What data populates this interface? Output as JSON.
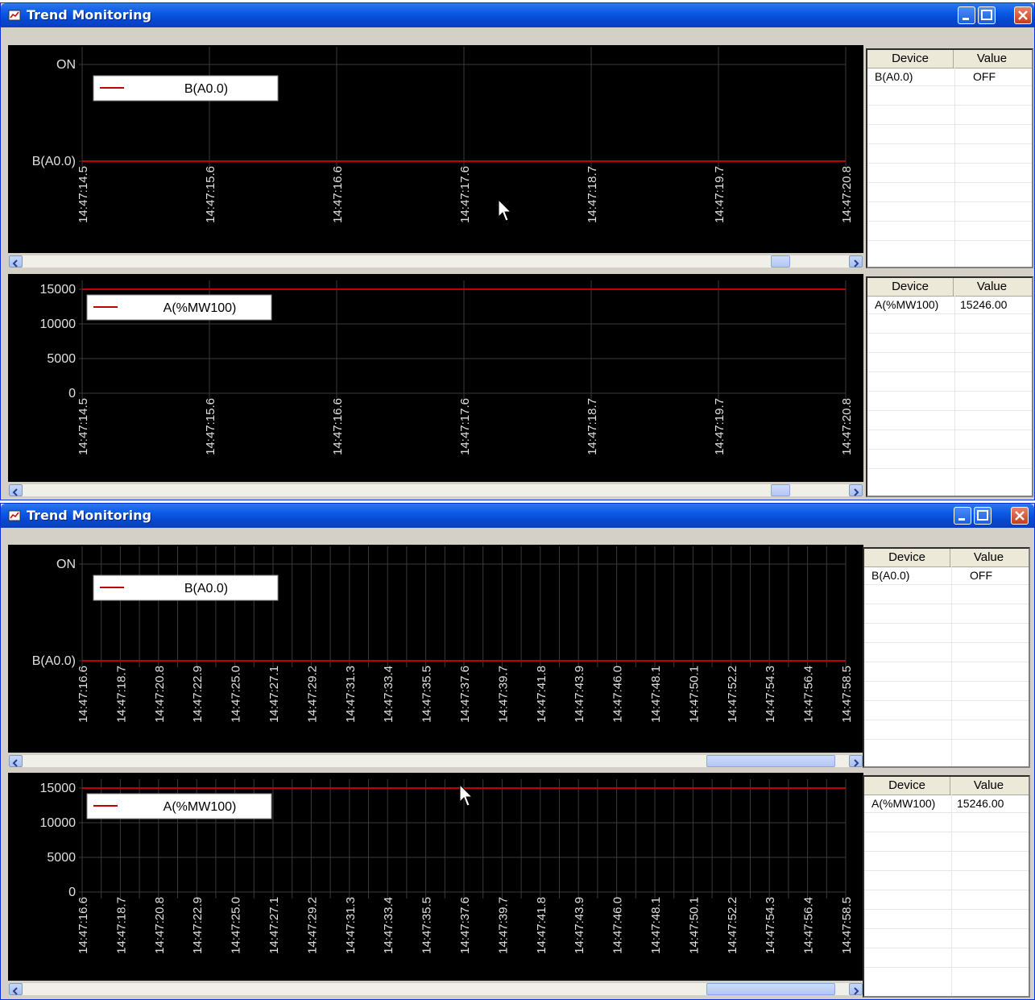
{
  "windows": [
    {
      "title": "Trend Monitoring",
      "charts": [
        {
          "legend": "B(A0.0)",
          "y_ticks": [
            "ON",
            "B(A0.0)"
          ],
          "x_ticks": [
            "14:47:14.5",
            "14:47:15.6",
            "14:47:16.6",
            "14:47:17.6",
            "14:47:18.7",
            "14:47:19.7",
            "14:47:20.8"
          ],
          "grid_count": 6,
          "line_level": 0,
          "table": {
            "headers": [
              "Device",
              "Value"
            ],
            "rows": [
              [
                "B(A0.0)",
                "OFF"
              ]
            ]
          }
        },
        {
          "legend": "A(%MW100)",
          "y_ticks": [
            "15000",
            "10000",
            "5000",
            "0"
          ],
          "x_ticks": [
            "14:47:14.5",
            "14:47:15.6",
            "14:47:16.6",
            "14:47:17.6",
            "14:47:18.7",
            "14:47:19.7",
            "14:47:20.8"
          ],
          "grid_count": 6,
          "line_level": 15000,
          "table": {
            "headers": [
              "Device",
              "Value"
            ],
            "rows": [
              [
                "A(%MW100)",
                "15246.00"
              ]
            ]
          }
        }
      ]
    },
    {
      "title": "Trend Monitoring",
      "charts": [
        {
          "legend": "B(A0.0)",
          "y_ticks": [
            "ON",
            "B(A0.0)"
          ],
          "x_ticks": [
            "14:47:16.6",
            "14:47:18.7",
            "14:47:20.8",
            "14:47:22.9",
            "14:47:25.0",
            "14:47:27.1",
            "14:47:29.2",
            "14:47:31.3",
            "14:47:33.4",
            "14:47:35.5",
            "14:47:37.6",
            "14:47:39.7",
            "14:47:41.8",
            "14:47:43.9",
            "14:47:46.0",
            "14:47:48.1",
            "14:47:50.1",
            "14:47:52.2",
            "14:47:54.3",
            "14:47:56.4",
            "14:47:58.5"
          ],
          "grid_count": 40,
          "line_level": 0,
          "table": {
            "headers": [
              "Device",
              "Value"
            ],
            "rows": [
              [
                "B(A0.0)",
                "OFF"
              ]
            ]
          }
        },
        {
          "legend": "A(%MW100)",
          "y_ticks": [
            "15000",
            "10000",
            "5000",
            "0"
          ],
          "x_ticks": [
            "14:47:16.6",
            "14:47:18.7",
            "14:47:20.8",
            "14:47:22.9",
            "14:47:25.0",
            "14:47:27.1",
            "14:47:29.2",
            "14:47:31.3",
            "14:47:33.4",
            "14:47:35.5",
            "14:47:37.6",
            "14:47:39.7",
            "14:47:41.8",
            "14:47:43.9",
            "14:47:46.0",
            "14:47:48.1",
            "14:47:50.1",
            "14:47:52.2",
            "14:47:54.3",
            "14:47:56.4",
            "14:47:58.5"
          ],
          "grid_count": 40,
          "line_level": 15000,
          "table": {
            "headers": [
              "Device",
              "Value"
            ],
            "rows": [
              [
                "A(%MW100)",
                "15246.00"
              ]
            ]
          }
        }
      ]
    }
  ],
  "chart_data": [
    {
      "type": "line",
      "series": [
        {
          "name": "B(A0.0)",
          "x": [
            "14:47:14.5",
            "14:47:20.8"
          ],
          "values": [
            "OFF",
            "OFF"
          ]
        }
      ],
      "ylim": [
        "B(A0.0)",
        "ON"
      ]
    },
    {
      "type": "line",
      "series": [
        {
          "name": "A(%MW100)",
          "x": [
            "14:47:14.5",
            "14:47:20.8"
          ],
          "values": [
            15246,
            15246
          ]
        }
      ],
      "ylim": [
        0,
        15000
      ]
    },
    {
      "type": "line",
      "series": [
        {
          "name": "B(A0.0)",
          "x": [
            "14:47:16.6",
            "14:47:58.5"
          ],
          "values": [
            "OFF",
            "OFF"
          ]
        }
      ],
      "ylim": [
        "B(A0.0)",
        "ON"
      ]
    },
    {
      "type": "line",
      "series": [
        {
          "name": "A(%MW100)",
          "x": [
            "14:47:16.6",
            "14:47:58.5"
          ],
          "values": [
            15246,
            15246
          ]
        }
      ],
      "ylim": [
        0,
        15000
      ]
    }
  ],
  "colors": {
    "series_line": "#c00000",
    "grid": "#404040",
    "chart_bg": "#000000",
    "titlebar": "#0a5ae6"
  },
  "icons": [
    "app-icon",
    "minimize-icon",
    "maximize-icon",
    "close-icon",
    "scroll-left-icon",
    "scroll-right-icon",
    "mouse-cursor-icon"
  ]
}
